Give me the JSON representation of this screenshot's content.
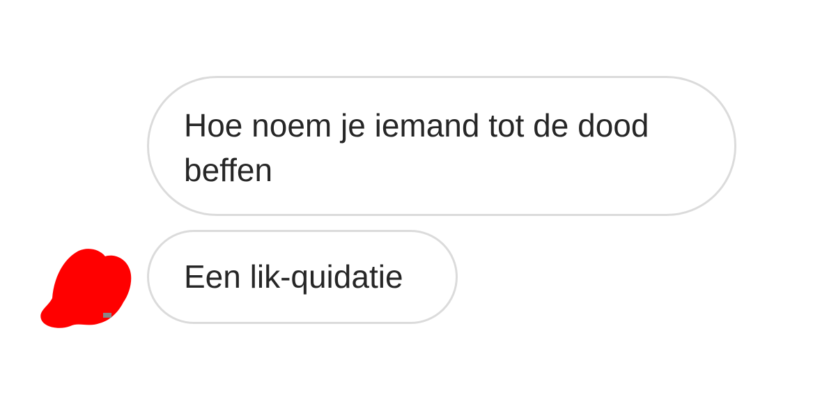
{
  "conversation": {
    "messages": [
      {
        "text": "Hoe noem je iemand tot de dood beffen"
      },
      {
        "text": "Een lik-quidatie"
      }
    ],
    "avatar": {
      "icon": "redacted-avatar-icon",
      "color": "#ff0000"
    }
  }
}
